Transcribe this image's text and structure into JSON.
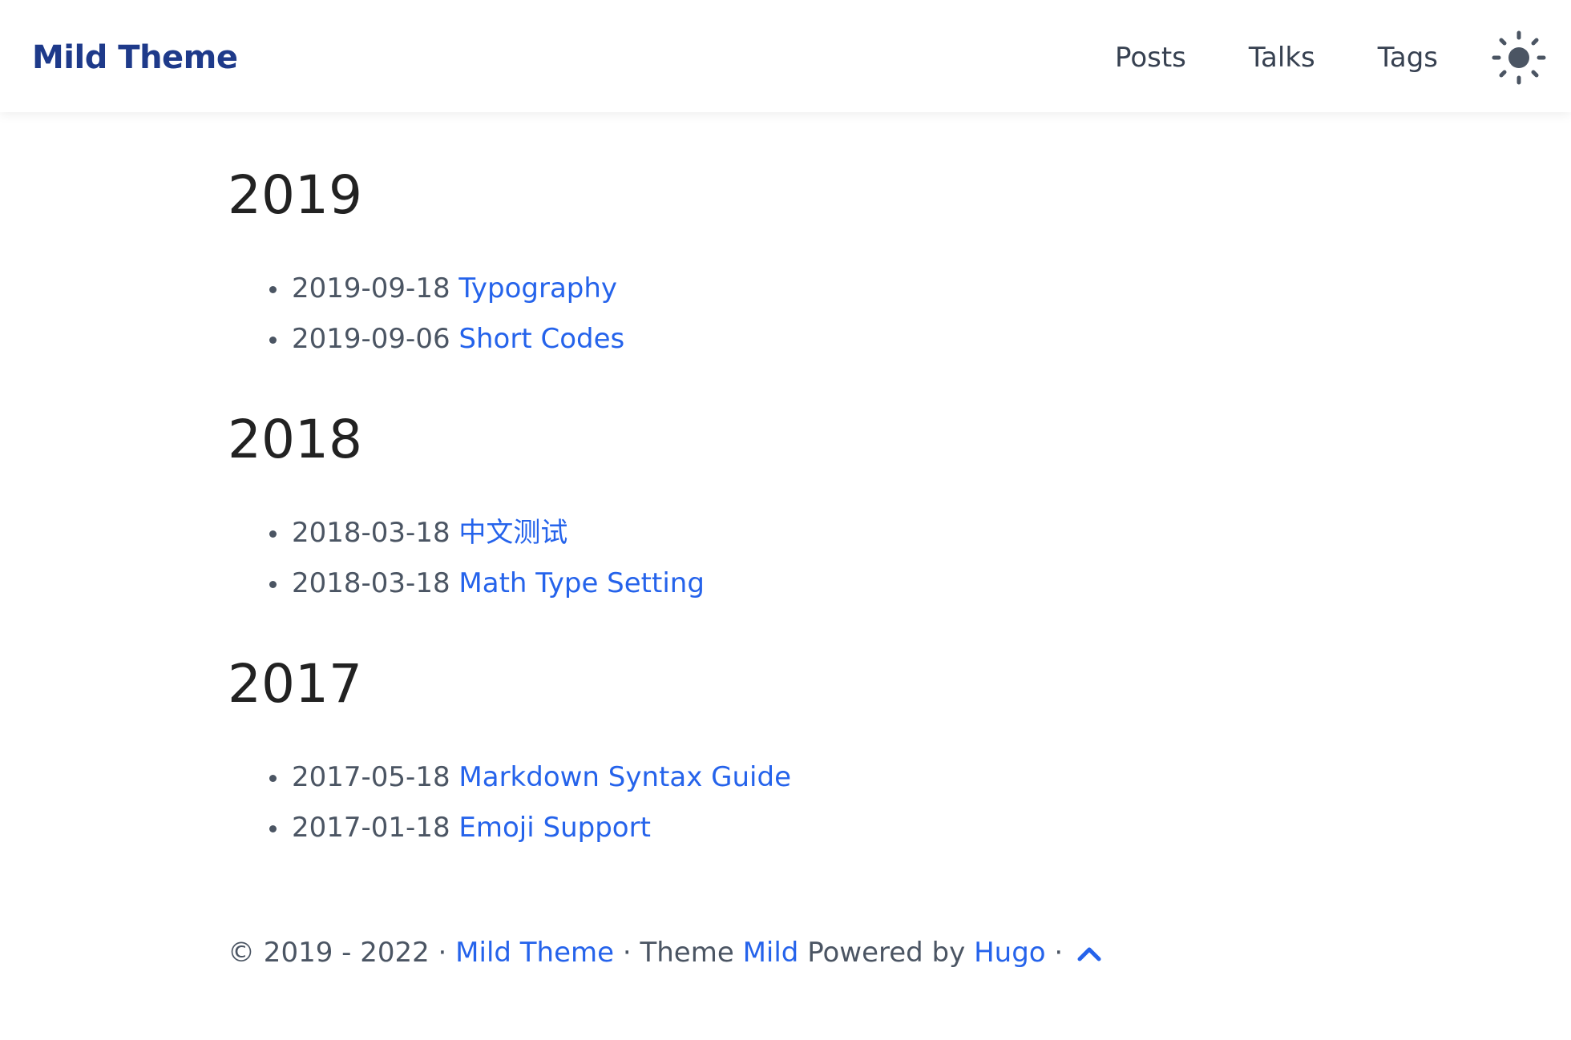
{
  "header": {
    "brand": "Mild Theme",
    "nav": {
      "posts": "Posts",
      "talks": "Talks",
      "tags": "Tags"
    },
    "theme_toggle_icon": "sun-icon"
  },
  "archive": [
    {
      "year": "2019",
      "posts": [
        {
          "date": "2019-09-18",
          "title": "Typography"
        },
        {
          "date": "2019-09-06",
          "title": "Short Codes"
        }
      ]
    },
    {
      "year": "2018",
      "posts": [
        {
          "date": "2018-03-18",
          "title": "中文测试"
        },
        {
          "date": "2018-03-18",
          "title": "Math Type Setting"
        }
      ]
    },
    {
      "year": "2017",
      "posts": [
        {
          "date": "2017-05-18",
          "title": "Markdown Syntax Guide"
        },
        {
          "date": "2017-01-18",
          "title": "Emoji Support"
        }
      ]
    }
  ],
  "footer": {
    "copyright": "© 2019 - 2022 · ",
    "site_link": "Mild Theme",
    "theme_text": " · Theme ",
    "theme_link": "Mild",
    "powered_text": " Powered by ",
    "hugo_link": "Hugo",
    "separator": " · ",
    "to_top_icon": "chevron-up-icon"
  },
  "colors": {
    "brand": "#1e3a8a",
    "link": "#2563eb",
    "text": "#4b5563",
    "heading": "#222222"
  }
}
